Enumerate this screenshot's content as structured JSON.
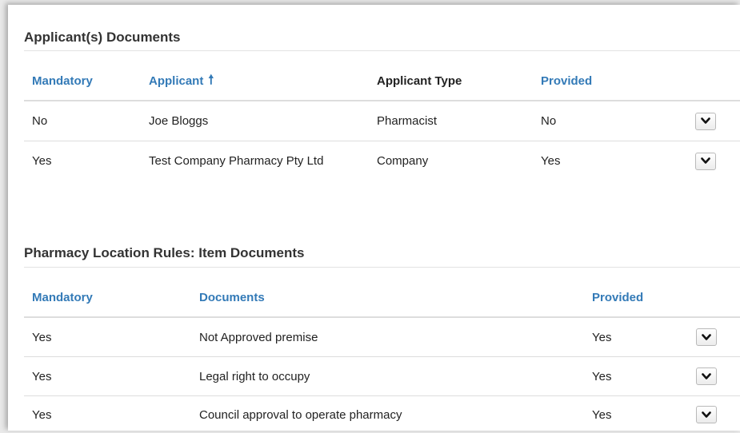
{
  "applicants_section": {
    "title": "Applicant(s) Documents",
    "headers": {
      "mandatory": "Mandatory",
      "applicant": "Applicant",
      "applicant_type": "Applicant Type",
      "provided": "Provided"
    },
    "sort_icon": "arrow-up-icon",
    "rows": [
      {
        "mandatory": "No",
        "applicant": "Joe Bloggs",
        "applicant_type": "Pharmacist",
        "provided": "No"
      },
      {
        "mandatory": "Yes",
        "applicant": "Test Company Pharmacy Pty Ltd",
        "applicant_type": "Company",
        "provided": "Yes"
      }
    ]
  },
  "item_section": {
    "title": "Pharmacy Location Rules: Item Documents",
    "headers": {
      "mandatory": "Mandatory",
      "documents": "Documents",
      "provided": "Provided"
    },
    "rows": [
      {
        "mandatory": "Yes",
        "document": "Not Approved premise",
        "provided": "Yes"
      },
      {
        "mandatory": "Yes",
        "document": "Legal right to occupy",
        "provided": "Yes"
      },
      {
        "mandatory": "Yes",
        "document": "Council approval to operate pharmacy",
        "provided": "Yes"
      }
    ]
  },
  "expand_icon": "chevron-down-icon",
  "colors": {
    "link": "#337ab7",
    "border": "#dddddd",
    "text": "#222222"
  }
}
